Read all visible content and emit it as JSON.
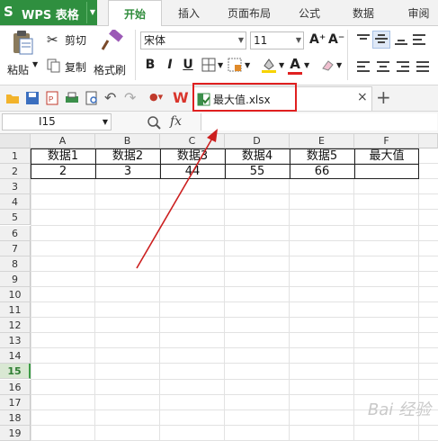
{
  "app": {
    "name": "WPS 表格",
    "logo": "S"
  },
  "menu_tabs": [
    "开始",
    "插入",
    "页面布局",
    "公式",
    "数据",
    "审阅"
  ],
  "ribbon": {
    "paste_label": "粘贴",
    "cut_label": "剪切",
    "copy_label": "复制",
    "format_painter_label": "格式刷",
    "font_name": "宋体",
    "font_size": "11",
    "bold": "B",
    "italic": "I",
    "underline": "U",
    "font_color_letter": "A",
    "grow_font": "A⁺",
    "shrink_font": "A⁻"
  },
  "document_tab": {
    "title": "最大值.xlsx",
    "close": "×",
    "new_tab": "+"
  },
  "formula_bar": {
    "cell_ref": "I15",
    "fx": "fx"
  },
  "columns": [
    "A",
    "B",
    "C",
    "D",
    "E",
    "F"
  ],
  "rows": [
    "1",
    "2",
    "3",
    "4",
    "5",
    "6",
    "7",
    "8",
    "9",
    "10",
    "11",
    "12",
    "13",
    "14",
    "15",
    "16",
    "17",
    "18",
    "19"
  ],
  "selected_row": "15",
  "table": {
    "headers": [
      "数据1",
      "数据2",
      "数据3",
      "数据4",
      "数据5",
      "最大值"
    ],
    "values": [
      "2",
      "3",
      "44",
      "55",
      "66",
      ""
    ]
  },
  "watermark": "Bai 经验",
  "colors": {
    "accent": "#2f8f3f",
    "highlight": "#e02020",
    "arrow": "#cc1f1f"
  }
}
